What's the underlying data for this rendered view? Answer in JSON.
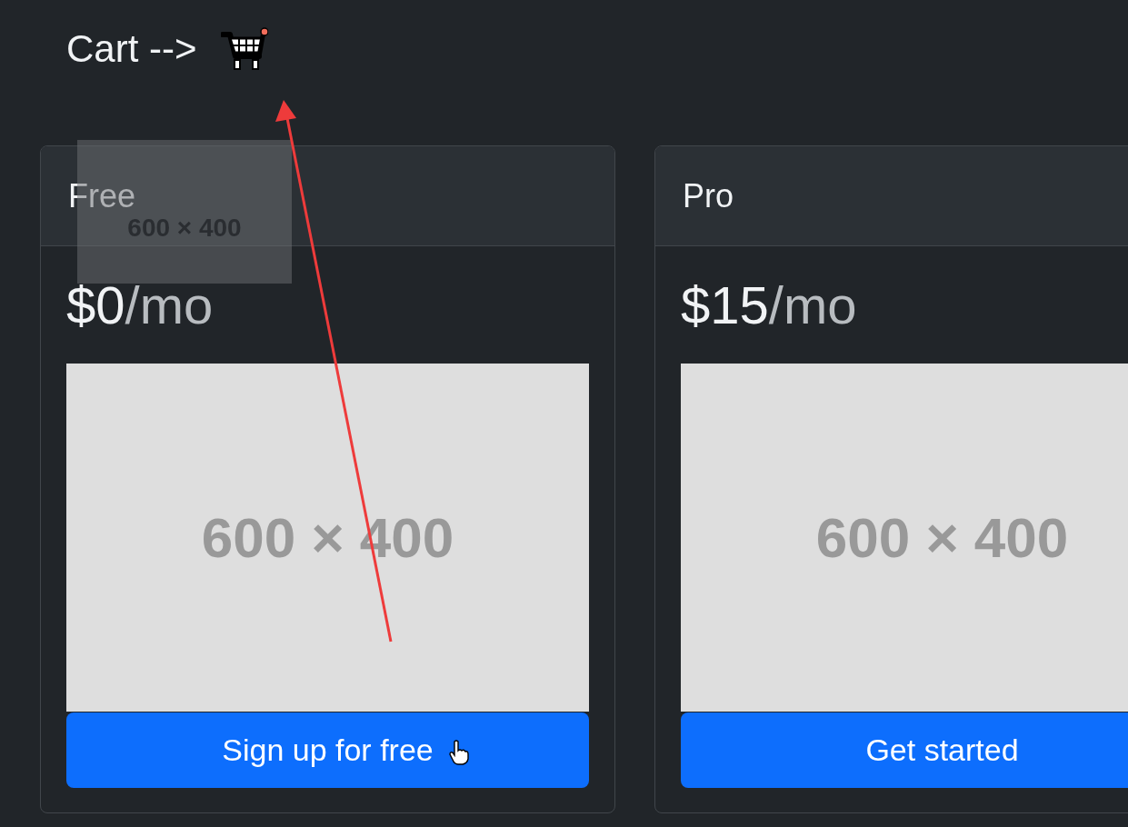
{
  "header": {
    "title": "Cart -->"
  },
  "plans": [
    {
      "name": "Free",
      "price": "$0",
      "period": "/mo",
      "image_text": "600 × 400",
      "button": "Sign up for free"
    },
    {
      "name": "Pro",
      "price": "$15",
      "period": "/mo",
      "image_text": "600 × 400",
      "button": "Get started"
    }
  ],
  "drag_ghost": {
    "text": "600 × 400"
  }
}
